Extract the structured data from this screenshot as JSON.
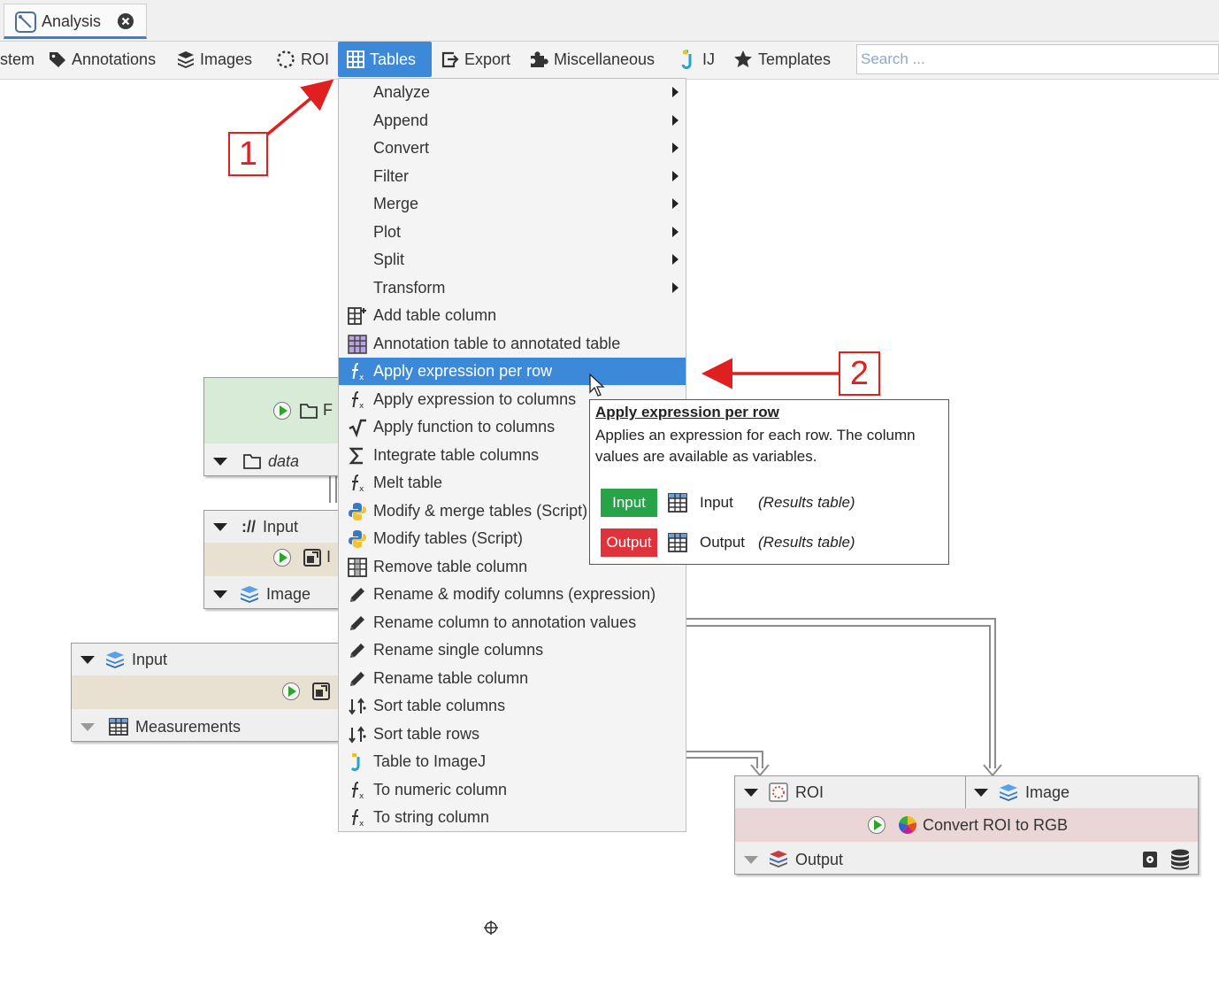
{
  "tab": {
    "label": "Analysis"
  },
  "toolbar": {
    "items": [
      "stem",
      "Annotations",
      "Images",
      "ROI",
      "Tables",
      "Export",
      "Miscellaneous",
      "IJ",
      "Templates"
    ],
    "search_placeholder": "Search ..."
  },
  "menu": {
    "items": [
      {
        "label": "Analyze",
        "icon": "",
        "submenu": true
      },
      {
        "label": "Append",
        "icon": "",
        "submenu": true
      },
      {
        "label": "Convert",
        "icon": "",
        "submenu": true
      },
      {
        "label": "Filter",
        "icon": "",
        "submenu": true
      },
      {
        "label": "Merge",
        "icon": "",
        "submenu": true
      },
      {
        "label": "Plot",
        "icon": "",
        "submenu": true
      },
      {
        "label": "Split",
        "icon": "",
        "submenu": true
      },
      {
        "label": "Transform",
        "icon": "",
        "submenu": true
      },
      {
        "label": "Add table column",
        "icon": "add-column-icon"
      },
      {
        "label": "Annotation table to annotated table",
        "icon": "annotation-table-icon"
      },
      {
        "label": "Apply expression per row",
        "icon": "function-icon",
        "highlighted": true
      },
      {
        "label": "Apply expression to columns",
        "icon": "function-icon"
      },
      {
        "label": "Apply function to columns",
        "icon": "sqrt-icon"
      },
      {
        "label": "Integrate table columns",
        "icon": "sigma-icon"
      },
      {
        "label": "Melt table",
        "icon": "function-icon"
      },
      {
        "label": "Modify & merge tables (Script)",
        "icon": "python-icon"
      },
      {
        "label": "Modify tables (Script)",
        "icon": "python-icon"
      },
      {
        "label": "Remove table column",
        "icon": "remove-column-icon"
      },
      {
        "label": "Rename & modify columns (expression)",
        "icon": "pencil-icon"
      },
      {
        "label": "Rename column to annotation values",
        "icon": "pencil-icon"
      },
      {
        "label": "Rename single columns",
        "icon": "pencil-icon"
      },
      {
        "label": "Rename table column",
        "icon": "pencil-icon"
      },
      {
        "label": "Sort table columns",
        "icon": "sort-icon"
      },
      {
        "label": "Sort table rows",
        "icon": "sort-icon"
      },
      {
        "label": "Table to ImageJ",
        "icon": "imagej-icon"
      },
      {
        "label": "To numeric column",
        "icon": "function-icon"
      },
      {
        "label": "To string column",
        "icon": "function-icon"
      }
    ]
  },
  "tooltip": {
    "title": "Apply expression per row",
    "description": "Applies an expression for each row. The column values are available as variables.",
    "slots": [
      {
        "kind": "Input",
        "name": "Input",
        "type": "(Results table)",
        "color": "#27a348"
      },
      {
        "kind": "Output",
        "name": "Output",
        "type": "(Results table)",
        "color": "#e0323a"
      }
    ]
  },
  "nodes": {
    "n1": {
      "output": "data",
      "label_partial": "F"
    },
    "n2": {
      "input": "Input",
      "output": "Image",
      "label_partial": "I"
    },
    "n3": {
      "input": "Input",
      "output": "Measurements"
    },
    "n4": {
      "input1": "ROI",
      "input2": "Image",
      "title": "Convert ROI to RGB",
      "output": "Output"
    }
  },
  "callouts": [
    "1",
    "2"
  ],
  "colors": {
    "accent": "#3c89d9",
    "input_green": "#27a348",
    "output_red": "#e0323a",
    "callout_red": "#e02020"
  }
}
